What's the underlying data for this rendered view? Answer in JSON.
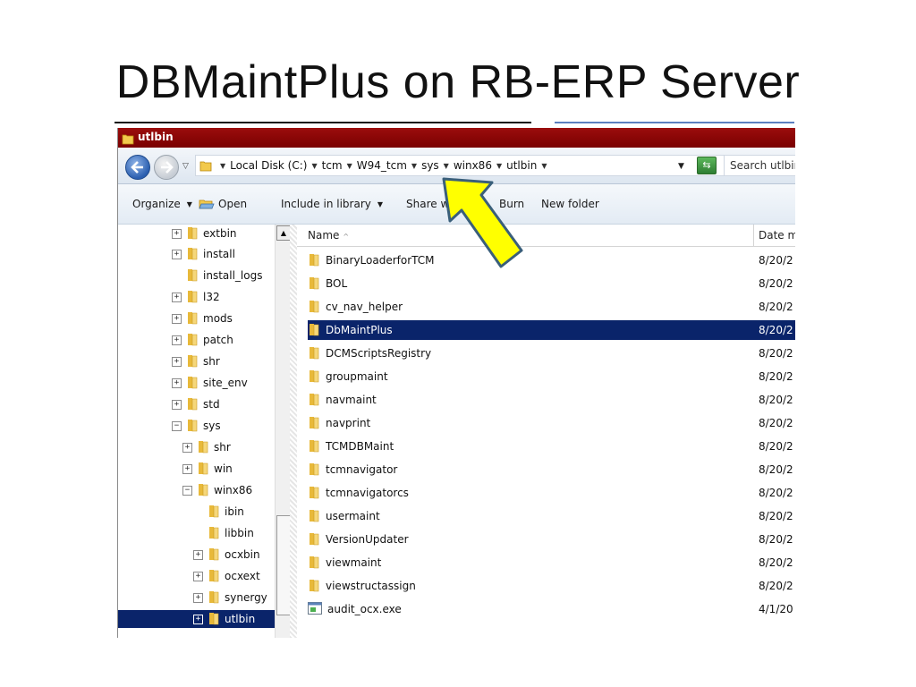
{
  "slide": {
    "title": "DBMaintPlus on RB-ERP Server"
  },
  "window": {
    "title": "utlbin",
    "address": {
      "crumbs": [
        "Local Disk (C:)",
        "tcm",
        "W94_tcm",
        "sys",
        "winx86",
        "utlbin"
      ],
      "search_placeholder": "Search utlbin"
    },
    "commands": {
      "organize": "Organize",
      "open": "Open",
      "include_in_library": "Include in library",
      "share_with": "Share w",
      "burn": "Burn",
      "new_folder": "New folder"
    },
    "tree": [
      {
        "label": "extbin"
      },
      {
        "label": "install"
      },
      {
        "label": "install_logs"
      },
      {
        "label": "l32"
      },
      {
        "label": "mods"
      },
      {
        "label": "patch"
      },
      {
        "label": "shr"
      },
      {
        "label": "site_env"
      },
      {
        "label": "std"
      },
      {
        "label": "sys"
      },
      {
        "label": "shr"
      },
      {
        "label": "win"
      },
      {
        "label": "winx86"
      },
      {
        "label": "ibin"
      },
      {
        "label": "libbin"
      },
      {
        "label": "ocxbin"
      },
      {
        "label": "ocxext"
      },
      {
        "label": "synergy"
      },
      {
        "label": "utlbin"
      }
    ],
    "columns": {
      "name": "Name",
      "date": "Date m"
    },
    "files": [
      {
        "name": "BinaryLoaderforTCM",
        "date": "8/20/2"
      },
      {
        "name": "BOL",
        "date": "8/20/2"
      },
      {
        "name": "cv_nav_helper",
        "date": "8/20/2"
      },
      {
        "name": "DbMaintPlus",
        "date": "8/20/2"
      },
      {
        "name": "DCMScriptsRegistry",
        "date": "8/20/2"
      },
      {
        "name": "groupmaint",
        "date": "8/20/2"
      },
      {
        "name": "navmaint",
        "date": "8/20/2"
      },
      {
        "name": "navprint",
        "date": "8/20/2"
      },
      {
        "name": "TCMDBMaint",
        "date": "8/20/2"
      },
      {
        "name": "tcmnavigator",
        "date": "8/20/2"
      },
      {
        "name": "tcmnavigatorcs",
        "date": "8/20/2"
      },
      {
        "name": "usermaint",
        "date": "8/20/2"
      },
      {
        "name": "VersionUpdater",
        "date": "8/20/2"
      },
      {
        "name": "viewmaint",
        "date": "8/20/2"
      },
      {
        "name": "viewstructassign",
        "date": "8/20/2"
      },
      {
        "name": "audit_ocx.exe",
        "date": "4/1/20"
      }
    ]
  },
  "colors": {
    "titlebar": "#8b0000",
    "selection": "#0a246a",
    "arrow_fill": "#ffff00",
    "arrow_stroke": "#3a5f7a"
  }
}
